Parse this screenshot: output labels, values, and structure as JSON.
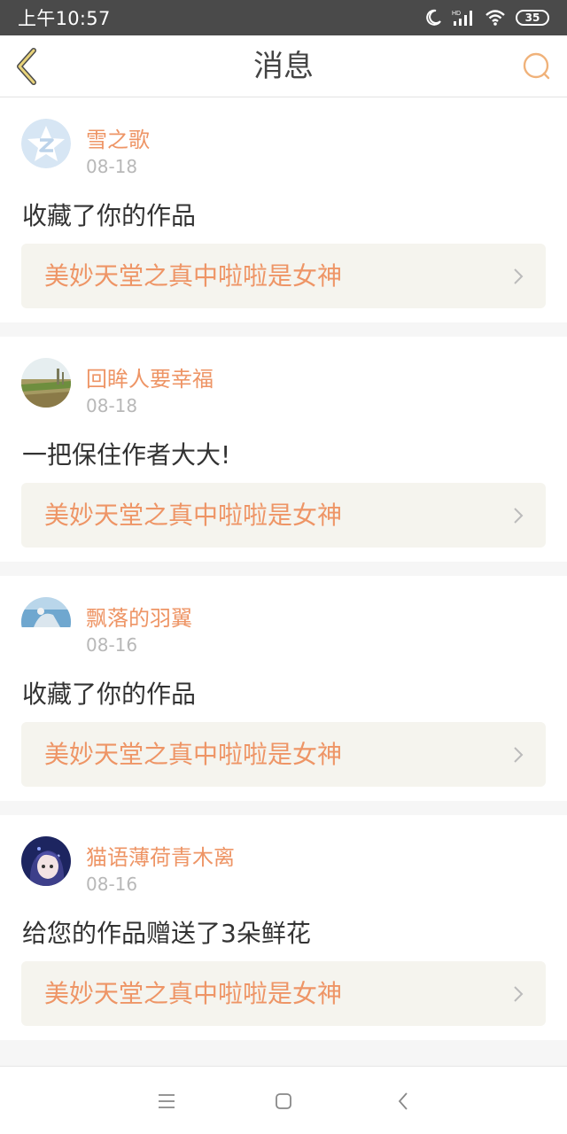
{
  "status_bar": {
    "time": "上午10:57",
    "battery": "35",
    "icons": [
      "moon-icon",
      "hd-signal-icon",
      "wifi-icon",
      "battery-icon"
    ]
  },
  "header": {
    "title": "消息",
    "back_icon": "chevron-left-icon",
    "search_icon": "search-icon",
    "accent_color": "#f0b27a",
    "back_color": "#c9a43b"
  },
  "messages": [
    {
      "username": "雪之歌",
      "date": "08-18",
      "message": "收藏了你的作品",
      "work_title": "美妙天堂之真中啦啦是女神",
      "avatar": "default-avatar-icon"
    },
    {
      "username": "回眸人要幸福",
      "date": "08-18",
      "message": "一把保住作者大大!",
      "work_title": "美妙天堂之真中啦啦是女神",
      "avatar": "landscape-photo"
    },
    {
      "username": "飘落的羽翼",
      "date": "08-16",
      "message": "收藏了你的作品",
      "work_title": "美妙天堂之真中啦啦是女神",
      "avatar": "sky-photo"
    },
    {
      "username": "猫语薄荷青木离",
      "date": "08-16",
      "message": "给您的作品赠送了3朵鲜花",
      "work_title": "美妙天堂之真中啦啦是女神",
      "avatar": "anime-portrait"
    }
  ],
  "colors": {
    "username": "#ee9566",
    "work_title": "#ee9566",
    "work_bg": "#f5f4ee",
    "date": "#b8b8b8",
    "status_bar": "#4a4a4a"
  },
  "nav_bar": {
    "icons": [
      "menu-icon",
      "home-icon",
      "back-icon"
    ]
  }
}
